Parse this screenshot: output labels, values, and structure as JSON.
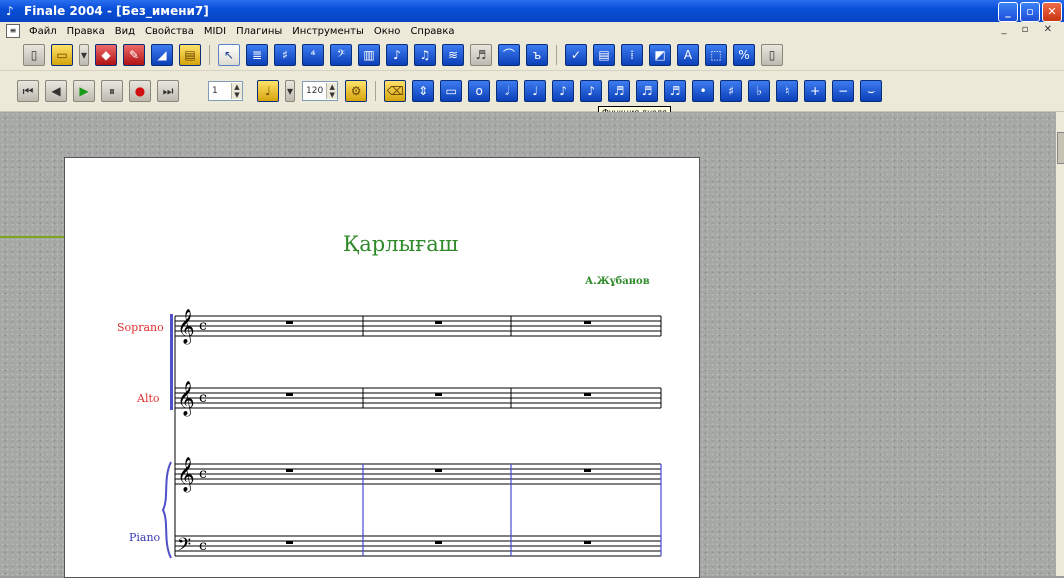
{
  "window": {
    "title": "Finale 2004 - [Без_имени7]",
    "buttons": {
      "minimize": "_",
      "maximize": "▫",
      "close": "✕"
    }
  },
  "menu": {
    "items": [
      "Файл",
      "Правка",
      "Вид",
      "Свойства",
      "MIDI",
      "Плагины",
      "Инструменты",
      "Окно",
      "Справка"
    ]
  },
  "toolbar2": {
    "measure_value": "1",
    "tempo_value": "120"
  },
  "tooltip": {
    "text": "Функция дуоля"
  },
  "score": {
    "title": "Қарлығаш",
    "composer": "А.Жұбанов",
    "instruments": {
      "soprano": "Soprano",
      "alto": "Alto",
      "piano": "Piano"
    }
  },
  "colors": {
    "title": "#2f8a2a",
    "soprano_label": "#e03030",
    "alto_label": "#e03030",
    "piano_label": "#3a3ab8",
    "barlines_piano": "#4848d8"
  }
}
